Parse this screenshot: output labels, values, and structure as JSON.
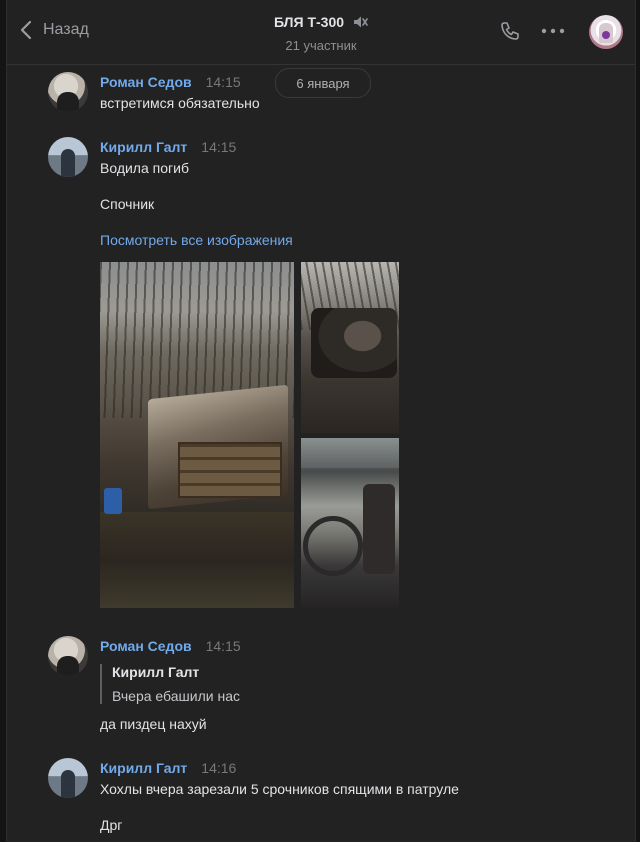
{
  "header": {
    "back_label": "Назад",
    "title": "БЛЯ Т-300",
    "subtitle": "21 участник",
    "icons": [
      "back-chevron-icon",
      "mute-icon",
      "call-icon",
      "more-icon",
      "chat-avatar"
    ]
  },
  "date_divider": "6 января",
  "messages": [
    {
      "author": "Роман Седов",
      "time": "14:15",
      "lines": [
        "встретимся обязательно"
      ]
    },
    {
      "author": "Кирилл Галт",
      "time": "14:15",
      "lines": [
        "Водила погиб",
        "Спочник"
      ],
      "link": "Посмотреть все изображения",
      "photos": [
        "burned-truck-photo",
        "wreck-photo",
        "cabin-photo"
      ]
    },
    {
      "author": "Роман Седов",
      "time": "14:15",
      "reply": {
        "author": "Кирилл Галт",
        "text": "Вчера ебашили нас"
      },
      "lines": [
        "да пиздец нахуй"
      ]
    },
    {
      "author": "Кирилл Галт",
      "time": "14:16",
      "lines": [
        "Хохлы вчера зарезали 5 срочников спящими в патруле",
        "Дрг"
      ]
    }
  ],
  "colors": {
    "background": "#222222",
    "author_link": "#71aaeb",
    "text": "#e1e3e6",
    "muted": "#76787a"
  }
}
